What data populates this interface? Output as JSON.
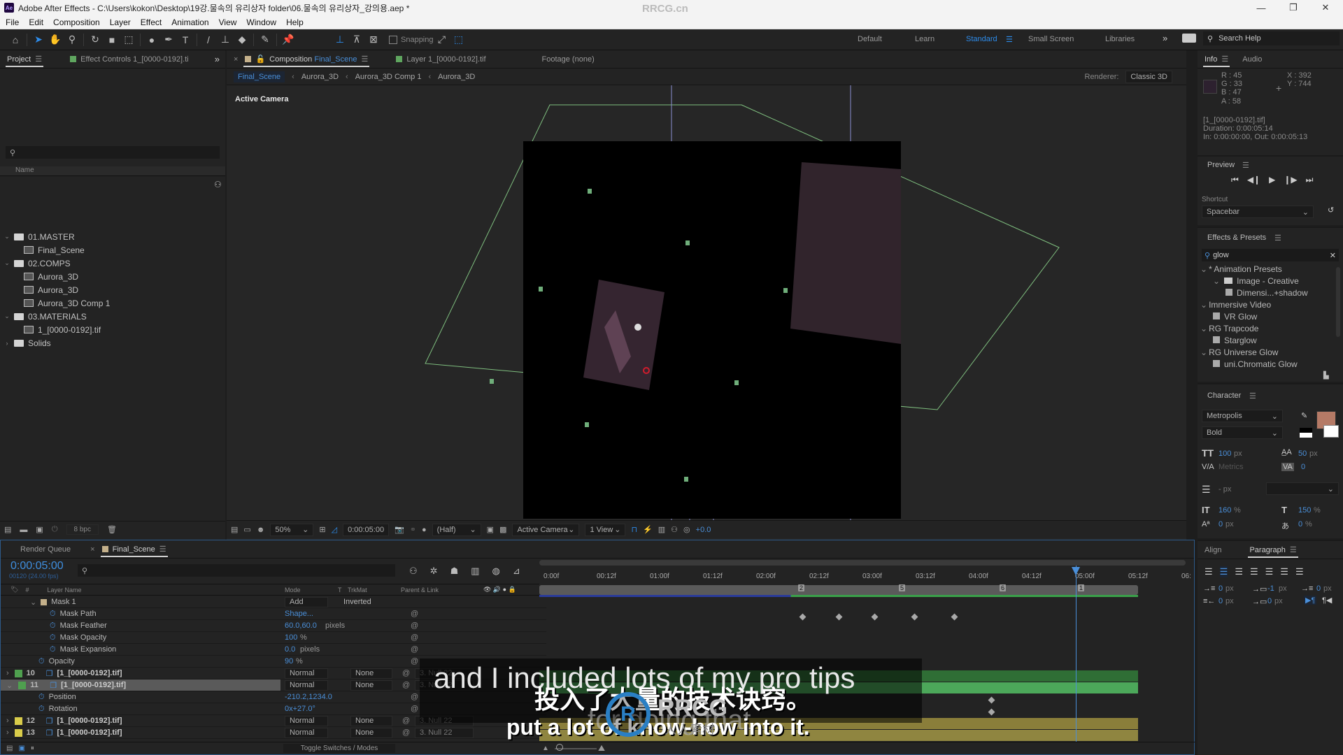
{
  "window": {
    "app_icon": "Ae",
    "title": "Adobe After Effects - C:\\Users\\kokon\\Desktop\\19강.물속의 유리상자 folder\\06.물속의 유리상자_강의용.aep *",
    "minimize": "—",
    "maximize": "❐",
    "close": "✕"
  },
  "watermark_header": "RRCG.cn",
  "menu": [
    "File",
    "Edit",
    "Composition",
    "Layer",
    "Effect",
    "Animation",
    "View",
    "Window",
    "Help"
  ],
  "toolbar": {
    "snapping_label": "Snapping",
    "workspaces": [
      {
        "label": "Default",
        "active": false
      },
      {
        "label": "Learn",
        "active": false
      },
      {
        "label": "Standard",
        "active": true
      },
      {
        "label": "Small Screen",
        "active": false
      },
      {
        "label": "Libraries",
        "active": false
      }
    ],
    "overflow": "»",
    "search_placeholder": "Search Help"
  },
  "project_panel": {
    "tab_project": "Project",
    "tab_effect_controls": "Effect Controls 1_[0000-0192].ti",
    "overflow": "»",
    "search_placeholder": "",
    "column_name": "Name",
    "items": [
      {
        "label": "01.MASTER",
        "type": "folder",
        "expanded": true,
        "level": 0
      },
      {
        "label": "Final_Scene",
        "type": "comp",
        "level": 1
      },
      {
        "label": "02.COMPS",
        "type": "folder",
        "expanded": true,
        "level": 0
      },
      {
        "label": "Aurora_3D",
        "type": "comp",
        "level": 1
      },
      {
        "label": "Aurora_3D",
        "type": "comp",
        "level": 1
      },
      {
        "label": "Aurora_3D Comp 1",
        "type": "comp",
        "level": 1
      },
      {
        "label": "03.MATERIALS",
        "type": "folder",
        "expanded": true,
        "level": 0
      },
      {
        "label": "1_[0000-0192].tif",
        "type": "sequence",
        "level": 1
      },
      {
        "label": "Solids",
        "type": "folder",
        "expanded": false,
        "level": 0
      }
    ],
    "bpc": "8 bpc"
  },
  "composition_panel": {
    "tab_comp_prefix": "Composition",
    "tab_comp_name": "Final_Scene",
    "tab_layer": "Layer 1_[0000-0192].tif",
    "tab_footage": "Footage (none)",
    "breadcrumbs": [
      "Final_Scene",
      "Aurora_3D",
      "Aurora_3D Comp 1",
      "Aurora_3D"
    ],
    "renderer_label": "Renderer:",
    "renderer_value": "Classic 3D",
    "view_label": "Active Camera",
    "footer": {
      "zoom": "50%",
      "timecode": "0:00:05:00",
      "resolution": "(Half)",
      "camera": "Active Camera",
      "views": "1 View",
      "exposure": "+0.0"
    }
  },
  "info_panel": {
    "tab_info": "Info",
    "tab_audio": "Audio",
    "r": "R : 45",
    "g": "G : 33",
    "b": "B : 47",
    "a": "A : 58",
    "x": "X : 392",
    "y": "Y : 744",
    "swatch_color": "#2d212f",
    "layer_name": "[1_[0000-0192].tif]",
    "duration": "Duration: 0:00:05:14",
    "inout": "In: 0:00:00:00, Out: 0:00:05:13"
  },
  "preview_panel": {
    "title": "Preview",
    "shortcut_label": "Shortcut",
    "shortcut_value": "Spacebar"
  },
  "effects_presets": {
    "title": "Effects & Presets",
    "search_value": "glow",
    "items": [
      {
        "label": "* Animation Presets",
        "level": 0,
        "type": "group"
      },
      {
        "label": "Image - Creative",
        "level": 1,
        "type": "folder"
      },
      {
        "label": "Dimensi...+shadow",
        "level": 2,
        "type": "preset"
      },
      {
        "label": "Immersive Video",
        "level": 0,
        "type": "group"
      },
      {
        "label": "VR Glow",
        "level": 1,
        "type": "effect"
      },
      {
        "label": "RG Trapcode",
        "level": 0,
        "type": "group"
      },
      {
        "label": "Starglow",
        "level": 1,
        "type": "effect"
      },
      {
        "label": "RG Universe Glow",
        "level": 0,
        "type": "group"
      },
      {
        "label": "uni.Chromatic Glow",
        "level": 1,
        "type": "effect"
      }
    ]
  },
  "character_panel": {
    "title": "Character",
    "font": "Metropolis",
    "style": "Bold",
    "fill_color": "#b57a66",
    "font_size": "100",
    "leading": "50",
    "kerning": "Metrics",
    "tracking": "0",
    "stroke_width": "- px",
    "vscale": "160",
    "hscale": "150",
    "baseline": "0",
    "tsume": "0",
    "unit_px": "px",
    "unit_pct": "%"
  },
  "paragraph_panel": {
    "tab_align": "Align",
    "tab_paragraph": "Paragraph",
    "indent_left": "0",
    "space_before": "-1",
    "indent_first": "0",
    "indent_right": "0",
    "space_after": "0",
    "unit": "px"
  },
  "timeline": {
    "tab_render_queue": "Render Queue",
    "tab_comp": "Final_Scene",
    "timecode": "0:00:05:00",
    "frame_info": "00120 (24.00 fps)",
    "columns": {
      "hash": "#",
      "layer_name": "Layer Name",
      "mode": "Mode",
      "t": "T",
      "trkmat": "TrkMat",
      "parent": "Parent & Link"
    },
    "ruler": [
      "0:00f",
      "00:12f",
      "01:00f",
      "01:12f",
      "02:00f",
      "02:12f",
      "03:00f",
      "03:12f",
      "04:00f",
      "04:12f",
      "05:00f",
      "05:12f",
      "06:"
    ],
    "markers": [
      "2",
      "5",
      "6",
      "1"
    ],
    "rows": [
      {
        "kind": "mask",
        "label": "Mask 1",
        "mode": "Add",
        "inverted": "Inverted"
      },
      {
        "kind": "prop",
        "label": "Mask Path",
        "value": "Shape...",
        "unit": ""
      },
      {
        "kind": "prop",
        "label": "Mask Feather",
        "value": "60.0,60.0",
        "unit": "pixels"
      },
      {
        "kind": "prop",
        "label": "Mask Opacity",
        "value": "100",
        "unit": "%"
      },
      {
        "kind": "prop",
        "label": "Mask Expansion",
        "value": "0.0",
        "unit": "pixels"
      },
      {
        "kind": "prop",
        "label": "Opacity",
        "value": "90",
        "unit": "%"
      },
      {
        "kind": "layer",
        "num": "10",
        "label": "[1_[0000-0192].tif]",
        "mode": "Normal",
        "trkmat": "None",
        "parent": "3. Null 22",
        "color": "#4fa04f"
      },
      {
        "kind": "layer",
        "num": "11",
        "label": "[1_[0000-0192].tif]",
        "mode": "Normal",
        "trkmat": "None",
        "parent": "3. Null 22",
        "color": "#4fa04f",
        "selected": true
      },
      {
        "kind": "prop",
        "label": "Position",
        "value": "-210.2,1234.0",
        "unit": ""
      },
      {
        "kind": "prop",
        "label": "Rotation",
        "value": "0x+27.0°",
        "unit": ""
      },
      {
        "kind": "layer",
        "num": "12",
        "label": "[1_[0000-0192].tif]",
        "mode": "Normal",
        "trkmat": "None",
        "parent": "3. Null 22",
        "color": "#d9cc4a"
      },
      {
        "kind": "layer",
        "num": "13",
        "label": "[1_[0000-0192].tif]",
        "mode": "Normal",
        "trkmat": "None",
        "parent": "3. Null 22",
        "color": "#d9cc4a"
      }
    ],
    "toggle_label": "Toggle Switches / Modes"
  },
  "subtitles": {
    "english_top": "and I included lots of my pro tips",
    "chinese": "投入了大量的技术诀窍。",
    "english_mid": "for doing that",
    "english_bottom": "put a lot of know-how into it.",
    "logo_text": "RRCG",
    "logo_sub": "人人素材"
  }
}
